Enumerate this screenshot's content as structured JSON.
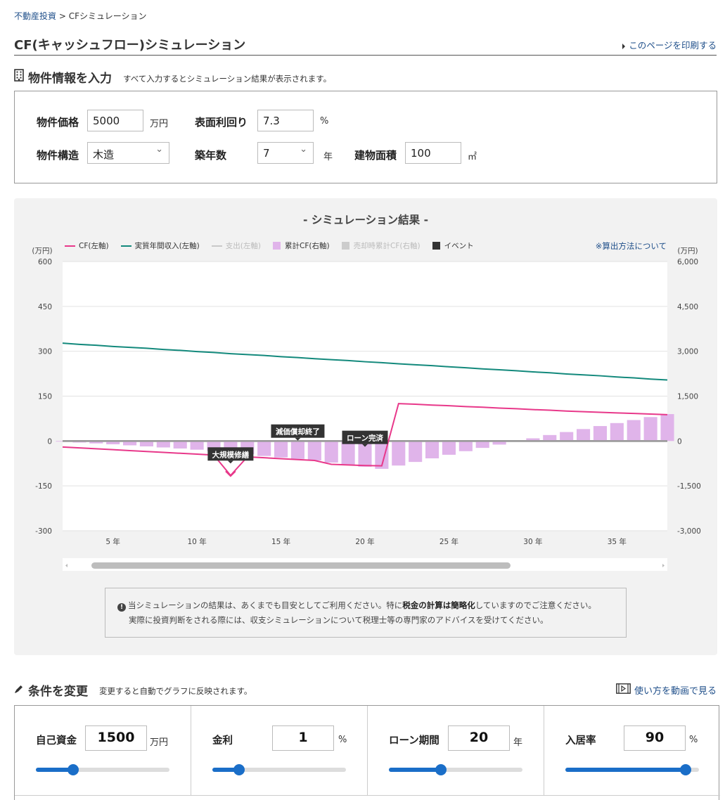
{
  "breadcrumb": {
    "home": "不動産投資",
    "sep": ">",
    "current": "CFシミュレーション"
  },
  "page": {
    "title": "CF(キャッシュフロー)シミュレーション",
    "print_link": "このページを印刷する"
  },
  "input_section": {
    "title": "物件情報を入力",
    "subtitle": "すべて入力するとシミュレーション結果が表示されます。",
    "price": {
      "label": "物件価格",
      "value": "5000",
      "unit": "万円"
    },
    "yield": {
      "label": "表面利回り",
      "value": "7.3",
      "unit": "%"
    },
    "structure": {
      "label": "物件構造",
      "value": "木造"
    },
    "age": {
      "label": "築年数",
      "value": "7",
      "unit": "年"
    },
    "area": {
      "label": "建物面積",
      "value": "100",
      "unit": "㎡"
    }
  },
  "result": {
    "title": "- シミュレーション結果 -",
    "calc_link": "※算出方法について",
    "left_unit": "(万円)",
    "right_unit": "(万円)",
    "legend": [
      {
        "label": "CF(左軸)",
        "color": "#e8388a",
        "kind": "line",
        "dim": false
      },
      {
        "label": "実質年間収入(左軸)",
        "color": "#13897c",
        "kind": "line",
        "dim": false
      },
      {
        "label": "支出(左軸)",
        "color": "#c8c8c8",
        "kind": "line",
        "dim": true
      },
      {
        "label": "累計CF(右軸)",
        "color": "#e0b4ea",
        "kind": "square",
        "dim": false
      },
      {
        "label": "売却時累計CF(右軸)",
        "color": "#cccccc",
        "kind": "square",
        "dim": true
      },
      {
        "label": "イベント",
        "color": "#333333",
        "kind": "square",
        "dim": false
      }
    ],
    "notice_line1_a": "当シミュレーションの結果は、あくまでも目安としてご利用ください。特に",
    "notice_line1_b": "税金の計算は簡略化",
    "notice_line1_c": "していますのでご注意ください。",
    "notice_line2": "実際に投資判断をされる際には、収支シミュレーションについて税理士等の専門家のアドバイスを受けてください。"
  },
  "chart_data": {
    "type": "line",
    "x": [
      2,
      3,
      4,
      5,
      6,
      7,
      8,
      9,
      10,
      11,
      12,
      13,
      14,
      15,
      16,
      17,
      18,
      19,
      20,
      21,
      22,
      23,
      24,
      25,
      26,
      27,
      28,
      29,
      30,
      31,
      32,
      33,
      34,
      35,
      36,
      37,
      38
    ],
    "xlim": [
      2,
      38
    ],
    "x_ticks": [
      "5 年",
      "10 年",
      "15 年",
      "20 年",
      "25 年",
      "30 年",
      "35 年"
    ],
    "x_tick_values": [
      5,
      10,
      15,
      20,
      25,
      30,
      35
    ],
    "y_left": {
      "ticks": [
        "600",
        "450",
        "300",
        "150",
        "0",
        "-150",
        "-300"
      ],
      "range": [
        -300,
        600
      ]
    },
    "y_right": {
      "ticks": [
        "6,000",
        "4,500",
        "3,000",
        "1,500",
        "0",
        "-1,500",
        "-3,000"
      ],
      "range": [
        -3000,
        6000
      ]
    },
    "series": [
      {
        "name": "CF(左軸)",
        "axis": "left",
        "color": "#e8388a",
        "values": [
          -20,
          -23,
          -26,
          -29,
          -32,
          -35,
          -38,
          -41,
          -44,
          -47,
          -115,
          -53,
          -56,
          -59,
          -62,
          -65,
          -78,
          -80,
          -82,
          -83,
          125,
          123,
          120,
          118,
          115,
          113,
          110,
          108,
          105,
          103,
          100,
          98,
          96,
          94,
          92,
          90,
          88
        ]
      },
      {
        "name": "実質年間収入(左軸)",
        "axis": "left",
        "color": "#13897c",
        "values": [
          327,
          323,
          320,
          316,
          313,
          310,
          306,
          303,
          299,
          296,
          292,
          289,
          286,
          282,
          279,
          275,
          272,
          269,
          265,
          262,
          258,
          255,
          252,
          248,
          245,
          241,
          238,
          235,
          231,
          228,
          224,
          221,
          218,
          214,
          211,
          207,
          204
        ]
      },
      {
        "name": "累計CF(右軸)",
        "axis": "right",
        "color": "#e0b4ea",
        "values": [
          -20,
          -50,
          -80,
          -110,
          -145,
          -180,
          -215,
          -250,
          -290,
          -330,
          -390,
          -440,
          -500,
          -550,
          -600,
          -650,
          -720,
          -790,
          -860,
          -930,
          -820,
          -700,
          -580,
          -460,
          -340,
          -230,
          -120,
          -20,
          90,
          200,
          300,
          400,
          500,
          600,
          700,
          800,
          900
        ]
      }
    ],
    "events": [
      {
        "label": "大規模修繕",
        "x": 12,
        "y": -115
      },
      {
        "label": "減価償却終了",
        "x": 16,
        "y": -62
      },
      {
        "label": "ローン完済",
        "x": 20,
        "y": -83
      }
    ]
  },
  "conditions": {
    "title": "条件を変更",
    "subtitle": "変更すると自動でグラフに反映されます。",
    "video_link": "使い方を動画で見る",
    "items": [
      {
        "label": "自己資金",
        "value": "1500",
        "unit": "万円",
        "level": 0.28
      },
      {
        "label": "金利",
        "value": "1",
        "unit": "%",
        "level": 0.2
      },
      {
        "label": "ローン期間",
        "value": "20",
        "unit": "年",
        "level": 0.39
      },
      {
        "label": "入居率",
        "value": "90",
        "unit": "%",
        "level": 0.9
      }
    ]
  }
}
